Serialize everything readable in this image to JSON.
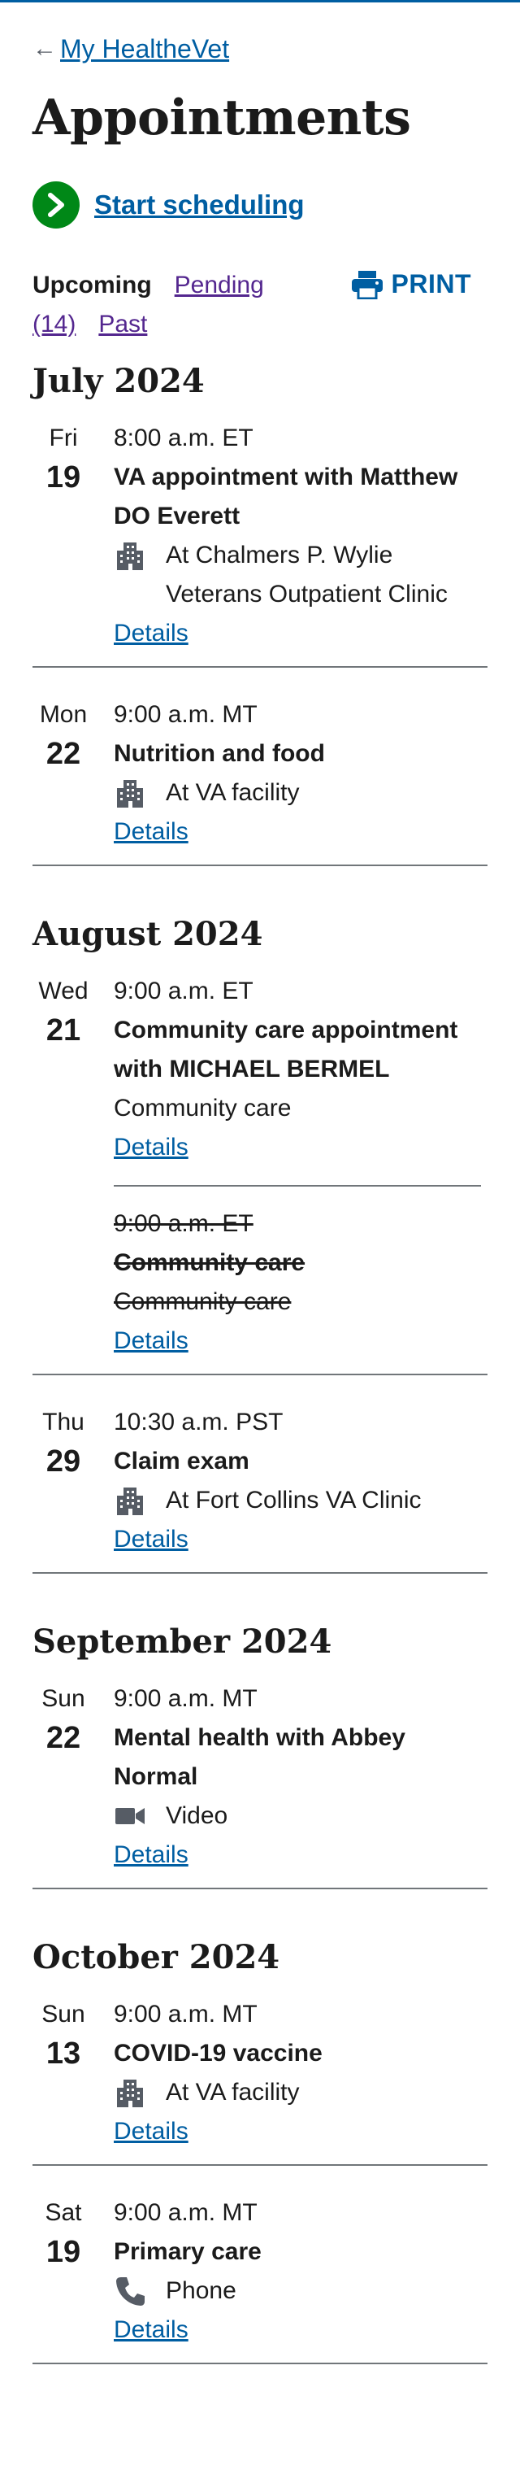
{
  "breadcrumb": {
    "label": "My HealtheVet"
  },
  "page_title": "Appointments",
  "start_scheduling": "Start scheduling",
  "tabs": {
    "upcoming": "Upcoming",
    "pending": "Pending (14)",
    "past": "Past"
  },
  "print_label": "PRINT",
  "details_label": "Details",
  "colors": {
    "link": "#005ea2",
    "visited_link": "#54278f",
    "start_green": "#008817",
    "divider": "#71767a",
    "icon": "#565c65"
  },
  "months": [
    {
      "label": "July 2024",
      "appointments": [
        {
          "dow": "Fri",
          "day": "19",
          "time": "8:00 a.m. ET",
          "title": "VA appointment with Matthew DO Everett",
          "location": "At Chalmers P. Wylie Veterans Outpatient Clinic",
          "icon": "building-icon"
        },
        {
          "dow": "Mon",
          "day": "22",
          "time": "9:00 a.m. MT",
          "title": "Nutrition and food",
          "location": "At VA facility",
          "icon": "building-icon"
        }
      ]
    },
    {
      "label": "August 2024",
      "appointments": [
        {
          "dow": "Wed",
          "day": "21",
          "time": "9:00 a.m. ET",
          "title": "Community care appointment with MICHAEL BERMEL",
          "location": "Community care",
          "canceled": {
            "time": "9:00 a.m. ET",
            "title": "Community care",
            "location": "Community care"
          }
        },
        {
          "dow": "Thu",
          "day": "29",
          "time": "10:30 a.m. PST",
          "title": "Claim exam",
          "location": "At Fort Collins VA Clinic",
          "icon": "building-icon"
        }
      ]
    },
    {
      "label": "September 2024",
      "appointments": [
        {
          "dow": "Sun",
          "day": "22",
          "time": "9:00 a.m. MT",
          "title": "Mental health with Abbey Normal",
          "location": "Video",
          "icon": "video-icon"
        }
      ]
    },
    {
      "label": "October 2024",
      "appointments": [
        {
          "dow": "Sun",
          "day": "13",
          "time": "9:00 a.m. MT",
          "title": "COVID-19 vaccine",
          "location": "At VA facility",
          "icon": "building-icon"
        },
        {
          "dow": "Sat",
          "day": "19",
          "time": "9:00 a.m. MT",
          "title": "Primary care",
          "location": "Phone",
          "icon": "phone-icon"
        }
      ]
    }
  ]
}
